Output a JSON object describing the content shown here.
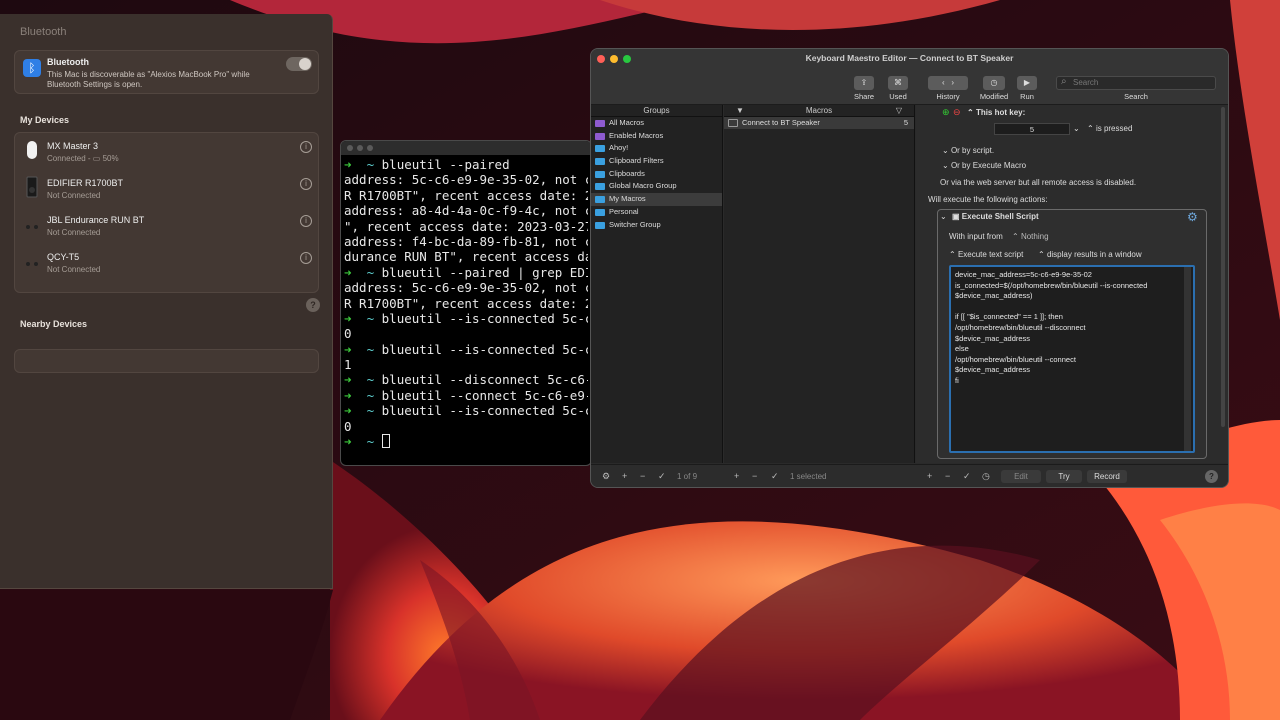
{
  "bluetooth": {
    "title": "Bluetooth",
    "main_title": "Bluetooth",
    "main_desc": "This Mac is discoverable as \"Alexios MacBook Pro\" while Bluetooth Settings is open.",
    "my_devices_label": "My Devices",
    "devices": [
      {
        "name": "MX Master 3",
        "status": "Connected - ▭ 50%"
      },
      {
        "name": "EDIFIER R1700BT",
        "status": "Not Connected"
      },
      {
        "name": "JBL Endurance RUN BT",
        "status": "Not Connected"
      },
      {
        "name": "QCY-T5",
        "status": "Not Connected"
      }
    ],
    "nearby_label": "Nearby Devices",
    "help": "?"
  },
  "terminal": {
    "lines": [
      {
        "prompt": true,
        "text": "blueutil --paired"
      },
      {
        "prompt": false,
        "text": "address: 5c-c6-e9-9e-35-02, not co"
      },
      {
        "prompt": false,
        "text": "R R1700BT\", recent access date: 20"
      },
      {
        "prompt": false,
        "text": "address: a8-4d-4a-0c-f9-4c, not co"
      },
      {
        "prompt": false,
        "text": "\", recent access date: 2023-03-27"
      },
      {
        "prompt": false,
        "text": "address: f4-bc-da-89-fb-81, not co"
      },
      {
        "prompt": false,
        "text": "durance RUN BT\", recent access dat"
      },
      {
        "prompt": true,
        "text": "blueutil --paired | grep EDIF"
      },
      {
        "prompt": false,
        "text": "address: 5c-c6-e9-9e-35-02, not co"
      },
      {
        "prompt": false,
        "text": "R R1700BT\", recent access date: 20"
      },
      {
        "prompt": true,
        "text": "blueutil --is-connected 5c-c6"
      },
      {
        "prompt": false,
        "text": "0"
      },
      {
        "prompt": true,
        "text": "blueutil --is-connected 5c-c6"
      },
      {
        "prompt": false,
        "text": "1"
      },
      {
        "prompt": true,
        "text": "blueutil --disconnect 5c-c6-e"
      },
      {
        "prompt": true,
        "text": "blueutil --connect 5c-c6-e9-9"
      },
      {
        "prompt": true,
        "text": "blueutil --is-connected 5c-c6"
      },
      {
        "prompt": false,
        "text": "0"
      }
    ],
    "prompt_symbol": "➜",
    "tilde": "~"
  },
  "km": {
    "title": "Keyboard Maestro Editor — Connect to BT Speaker",
    "toolbar": {
      "share": "Share",
      "used": "Used",
      "history": "History",
      "modified": "Modified",
      "run": "Run",
      "search_label": "Search",
      "search_placeholder": "Search"
    },
    "groups_header": "Groups",
    "macros_header": "Macros",
    "groups": [
      {
        "label": "All Macros",
        "color": "#8e5bd0"
      },
      {
        "label": "Enabled Macros",
        "color": "#8e5bd0"
      },
      {
        "label": "Ahoy!",
        "color": "#3aa0e0"
      },
      {
        "label": "Clipboard Filters",
        "color": "#3aa0e0"
      },
      {
        "label": "Clipboards",
        "color": "#3aa0e0"
      },
      {
        "label": "Global Macro Group",
        "color": "#3aa0e0"
      },
      {
        "label": "My Macros",
        "color": "#3aa0e0"
      },
      {
        "label": "Personal",
        "color": "#3aa0e0"
      },
      {
        "label": "Switcher Group",
        "color": "#3aa0e0"
      }
    ],
    "macro": {
      "name": "Connect to BT Speaker",
      "count": "5"
    },
    "detail": {
      "hotkey_label": "This hot key:",
      "hotkey_value": "5",
      "is_pressed": "is pressed",
      "or_by_script": "Or by script.",
      "or_by_execute": "Or by Execute Macro",
      "web_server": "Or via the web server but all remote access is disabled.",
      "will_execute": "Will execute the following actions:",
      "action_title": "Execute Shell Script",
      "with_input_from": "With input from",
      "nothing": "Nothing",
      "execute_text_script": "Execute text script",
      "display_results": "display results in a window",
      "script": "device_mac_address=5c-c6-e9-9e-35-02\nis_connected=$(/opt/homebrew/bin/blueutil --is-connected\n$device_mac_address)\n\nif [[ \"$is_connected\" == 1 ]]; then\n/opt/homebrew/bin/blueutil --disconnect\n$device_mac_address\nelse\n/opt/homebrew/bin/blueutil --connect\n$device_mac_address\nfi"
    },
    "footer": {
      "groups_count": "1 of 9",
      "selected": "1 selected",
      "edit": "Edit",
      "try": "Try",
      "record": "Record",
      "help": "?"
    }
  }
}
